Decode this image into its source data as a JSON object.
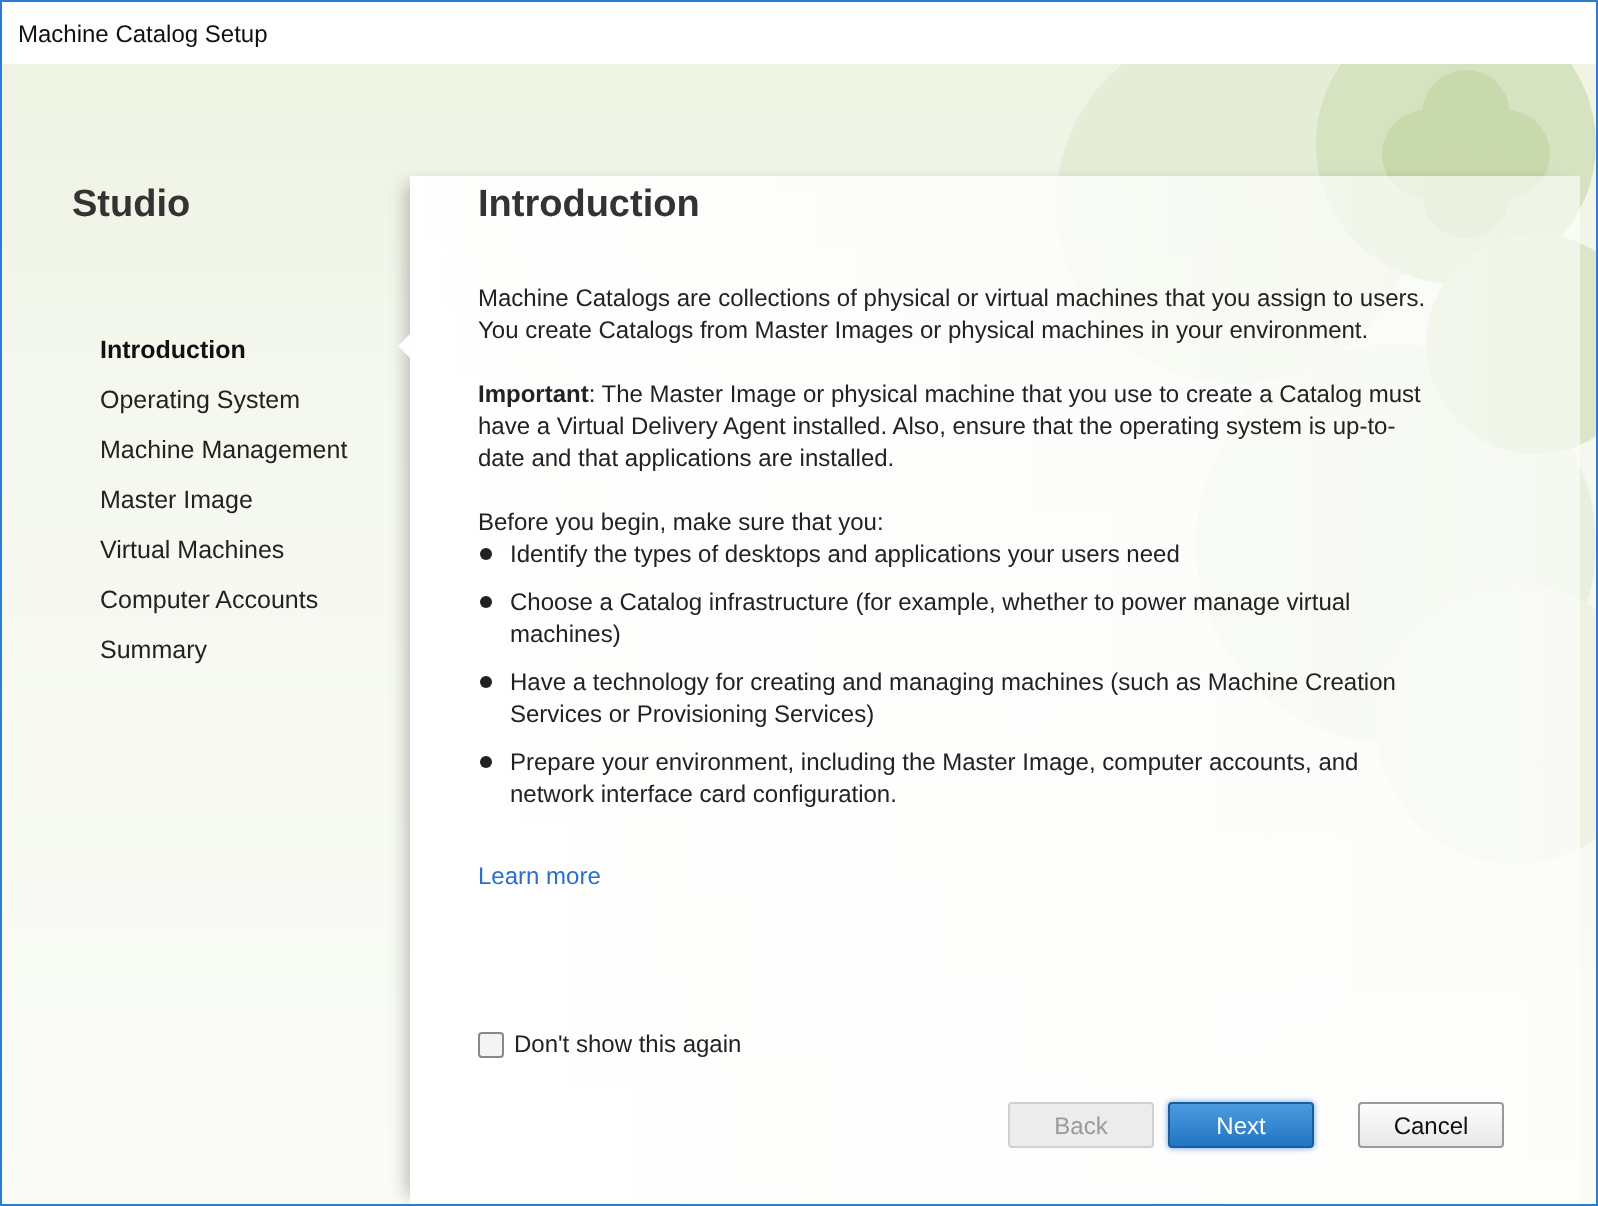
{
  "window": {
    "title": "Machine Catalog Setup"
  },
  "sidebar": {
    "title": "Studio",
    "items": [
      {
        "label": "Introduction",
        "selected": true
      },
      {
        "label": "Operating System",
        "selected": false
      },
      {
        "label": "Machine Management",
        "selected": false
      },
      {
        "label": "Master Image",
        "selected": false
      },
      {
        "label": "Virtual Machines",
        "selected": false
      },
      {
        "label": "Computer Accounts",
        "selected": false
      },
      {
        "label": "Summary",
        "selected": false
      }
    ]
  },
  "content": {
    "heading": "Introduction",
    "paragraphs": [
      "Machine Catalogs are collections of physical or virtual machines that you assign to users. You create Catalogs from Master Images or physical machines in your environment.",
      "**Important**: The Master Image or physical machine that you use to create a Catalog must have a Virtual Delivery Agent installed. Also, ensure that the operating system is up-to-date and that applications are installed."
    ],
    "list_intro": "Before you begin, make sure that you:",
    "bullets": [
      "Identify the types of desktops and applications your users need",
      "Choose a Catalog infrastructure (for example, whether to power manage virtual machines)",
      "Have a technology for creating and managing machines (such as Machine Creation Services or Provisioning Services)",
      "Prepare your environment, including the Master Image, computer accounts, and network interface card configuration."
    ],
    "link": "Learn more",
    "checkbox": {
      "label": "Don't show this again",
      "checked": false
    }
  },
  "buttons": [
    {
      "label": "Back",
      "kind": "secondary",
      "disabled": true
    },
    {
      "label": "Next",
      "kind": "primary",
      "disabled": false
    },
    {
      "label": "Cancel",
      "kind": "secondary",
      "disabled": false
    }
  ]
}
